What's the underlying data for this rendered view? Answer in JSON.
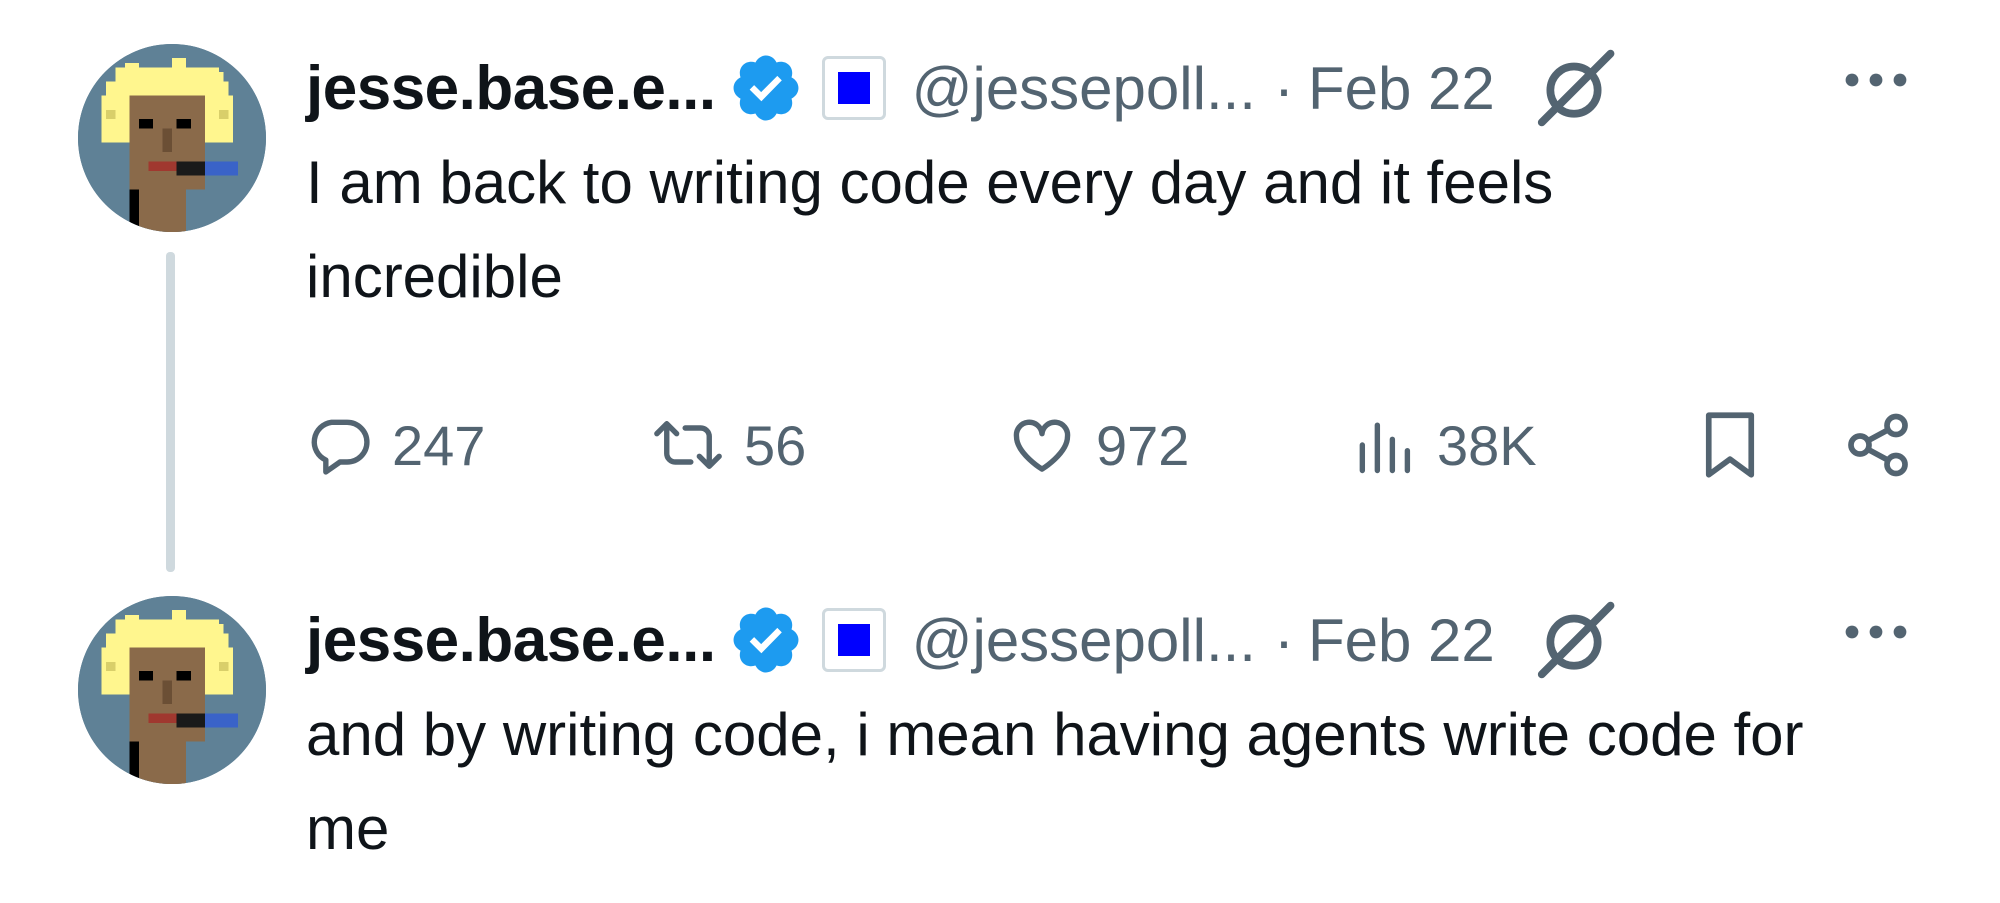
{
  "tweets": [
    {
      "display_name": "jesse.base.e...",
      "handle": "@jessepoll...",
      "separator": "·",
      "date": "Feb 22",
      "text": "I am back to writing code every day and it feels incredible",
      "stats": {
        "replies": "247",
        "reposts": "56",
        "likes": "972",
        "views": "38K"
      }
    },
    {
      "display_name": "jesse.base.e...",
      "handle": "@jessepoll...",
      "separator": "·",
      "date": "Feb 22",
      "text": "and by writing code, i mean having agents write code for me"
    }
  ],
  "icons": {
    "verified": "verified-badge-icon",
    "affiliate": "affiliate-badge-icon",
    "grok": "grok-icon",
    "more": "more-options-icon",
    "reply": "reply-icon",
    "repost": "repost-icon",
    "like": "heart-icon",
    "views": "views-chart-icon",
    "bookmark": "bookmark-icon",
    "share": "share-icon"
  },
  "colors": {
    "text_primary": "#0f1419",
    "text_secondary": "#536471",
    "verified_blue": "#1d9bf0",
    "affiliate_blue": "#0000ff",
    "thread_line": "#cfd9de"
  }
}
